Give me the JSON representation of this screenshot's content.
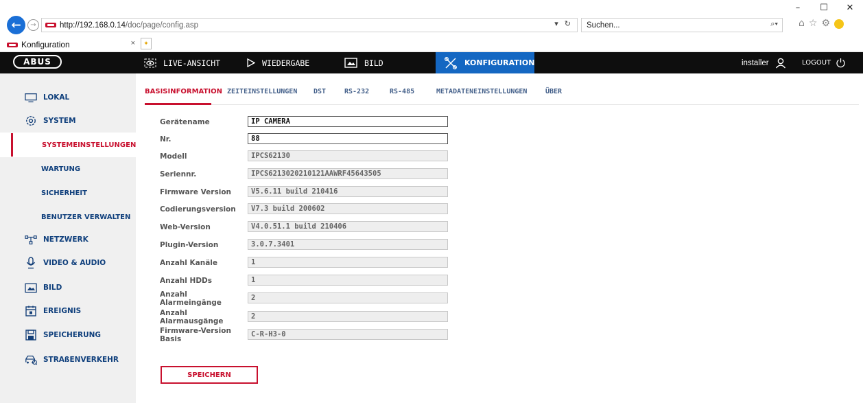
{
  "browser": {
    "url_host": "http://192.168.0.14",
    "url_path": "/doc/page/config.asp",
    "addr_tools": "▾ ↻",
    "search_placeholder": "Suchen...",
    "tab_title": "Konfiguration",
    "window_controls": [
      "–",
      "☐",
      "✕"
    ]
  },
  "nav": {
    "logo": "ABUS",
    "items": [
      {
        "label": "LIVE-ANSICHT",
        "icon": "eye-icon"
      },
      {
        "label": "WIEDERGABE",
        "icon": "play-icon"
      },
      {
        "label": "BILD",
        "icon": "image-icon"
      },
      {
        "label": "KONFIGURATION",
        "icon": "tools-icon",
        "active": true
      }
    ],
    "user": "installer",
    "logout": "LOGOUT"
  },
  "sidebar": {
    "items": [
      {
        "label": "LOKAL",
        "icon": "monitor-icon"
      },
      {
        "label": "SYSTEM",
        "icon": "gear-icon"
      },
      {
        "label": "SYSTEMEINSTELLUNGEN",
        "sub": true,
        "active": true
      },
      {
        "label": "WARTUNG",
        "sub": true
      },
      {
        "label": "SICHERHEIT",
        "sub": true
      },
      {
        "label": "BENUTZER VERWALTEN",
        "sub": true
      },
      {
        "label": "NETZWERK",
        "icon": "network-icon"
      },
      {
        "label": "VIDEO & AUDIO",
        "icon": "microphone-icon"
      },
      {
        "label": "BILD",
        "icon": "image-icon"
      },
      {
        "label": "EREIGNIS",
        "icon": "calendar-icon"
      },
      {
        "label": "SPEICHERUNG",
        "icon": "floppy-icon"
      },
      {
        "label": "STRAßENVERKEHR",
        "icon": "car-icon"
      }
    ]
  },
  "tabs": [
    {
      "label": "BASISINFORMATION",
      "active": true
    },
    {
      "label": "ZEITEINSTELLUNGEN"
    },
    {
      "label": "DST"
    },
    {
      "label": "RS-232"
    },
    {
      "label": "RS-485"
    },
    {
      "label": "METADATENEINSTELLUNGEN"
    },
    {
      "label": "ÜBER"
    }
  ],
  "form": {
    "fields": [
      {
        "label": "Gerätename",
        "value": "IP CAMERA",
        "editable": true
      },
      {
        "label": "Nr.",
        "value": "88",
        "editable": true
      },
      {
        "label": "Modell",
        "value": "IPCS62130"
      },
      {
        "label": "Seriennr.",
        "value": "IPCS6213020210121AAWRF45643505"
      },
      {
        "label": "Firmware Version",
        "value": "V5.6.11 build 210416"
      },
      {
        "label": "Codierungsversion",
        "value": "V7.3 build 200602"
      },
      {
        "label": "Web-Version",
        "value": "V4.0.51.1 build 210406"
      },
      {
        "label": "Plugin-Version",
        "value": "3.0.7.3401"
      },
      {
        "label": "Anzahl Kanäle",
        "value": "1"
      },
      {
        "label": "Anzahl HDDs",
        "value": "1"
      },
      {
        "label": "Anzahl Alarmeingänge",
        "value": "2"
      },
      {
        "label": "Anzahl Alarmausgänge",
        "value": "2"
      },
      {
        "label": "Firmware-Version Basis",
        "value": "C-R-H3-0"
      }
    ],
    "save_label": "SPEICHERN"
  },
  "colors": {
    "accent_red": "#c8102e",
    "nav_active_blue": "#1467c2",
    "nav_bg": "#0e0e0e",
    "sidebar_text": "#0f3f7c"
  }
}
